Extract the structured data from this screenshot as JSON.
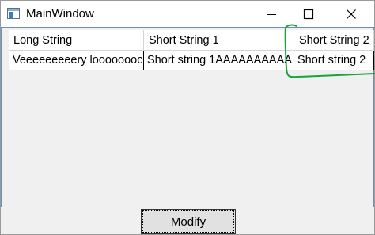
{
  "window": {
    "title": "MainWindow"
  },
  "grid": {
    "columns": [
      "Long String",
      "Short String 1",
      "Short String 2"
    ],
    "rows": [
      [
        "Veeeeeeeeery loooooooc",
        "Short string 1AAAAAAAAAA",
        "Short string 2"
      ]
    ]
  },
  "footer": {
    "modify_label": "Modify"
  },
  "colors": {
    "annotation": "#1aa33a",
    "client_border": "#6f8fb5"
  }
}
